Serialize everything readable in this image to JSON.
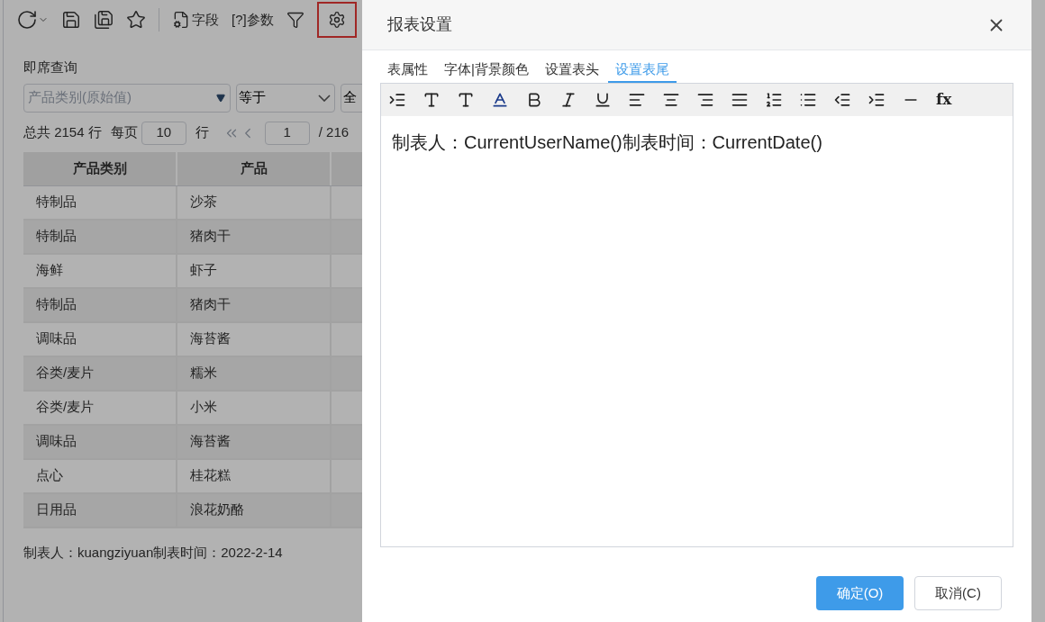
{
  "toolbar": {
    "fields_label": "字段",
    "params_label": "[?]参数",
    "settings_highlighted": true
  },
  "query": {
    "title": "即席查询",
    "field_placeholder": "产品类别(原始值)",
    "operator": "等于",
    "value": "全"
  },
  "pager": {
    "total": "总共 2154 行",
    "per_page_label": "每页",
    "per_page": "10",
    "rows_unit": "行",
    "page": "1",
    "page_count": "/ 216"
  },
  "table": {
    "columns": [
      "产品类别",
      "产品"
    ],
    "rows": [
      [
        "特制品",
        "沙茶"
      ],
      [
        "特制品",
        "猪肉干"
      ],
      [
        "海鲜",
        "虾子"
      ],
      [
        "特制品",
        "猪肉干"
      ],
      [
        "调味品",
        "海苔酱"
      ],
      [
        "谷类/麦片",
        "糯米"
      ],
      [
        "谷类/麦片",
        "小米"
      ],
      [
        "调味品",
        "海苔酱"
      ],
      [
        "点心",
        "桂花糕"
      ],
      [
        "日用品",
        "浪花奶酪"
      ]
    ]
  },
  "footer_text": "制表人：kuangziyuan制表时间：2022-2-14",
  "dialog": {
    "title": "报表设置",
    "tabs": [
      {
        "label": "表属性",
        "selected": false
      },
      {
        "label": "字体|背景颜色",
        "selected": false
      },
      {
        "label": "设置表头",
        "selected": false
      },
      {
        "label": "设置表尾",
        "selected": true
      }
    ],
    "formula_label": "fx",
    "editor_text": "制表人：CurrentUserName()制表时间：CurrentDate()",
    "buttons": [
      {
        "label": "确定(O)",
        "kind": "primary"
      },
      {
        "label": "取消(C)",
        "kind": "secondary"
      }
    ]
  }
}
